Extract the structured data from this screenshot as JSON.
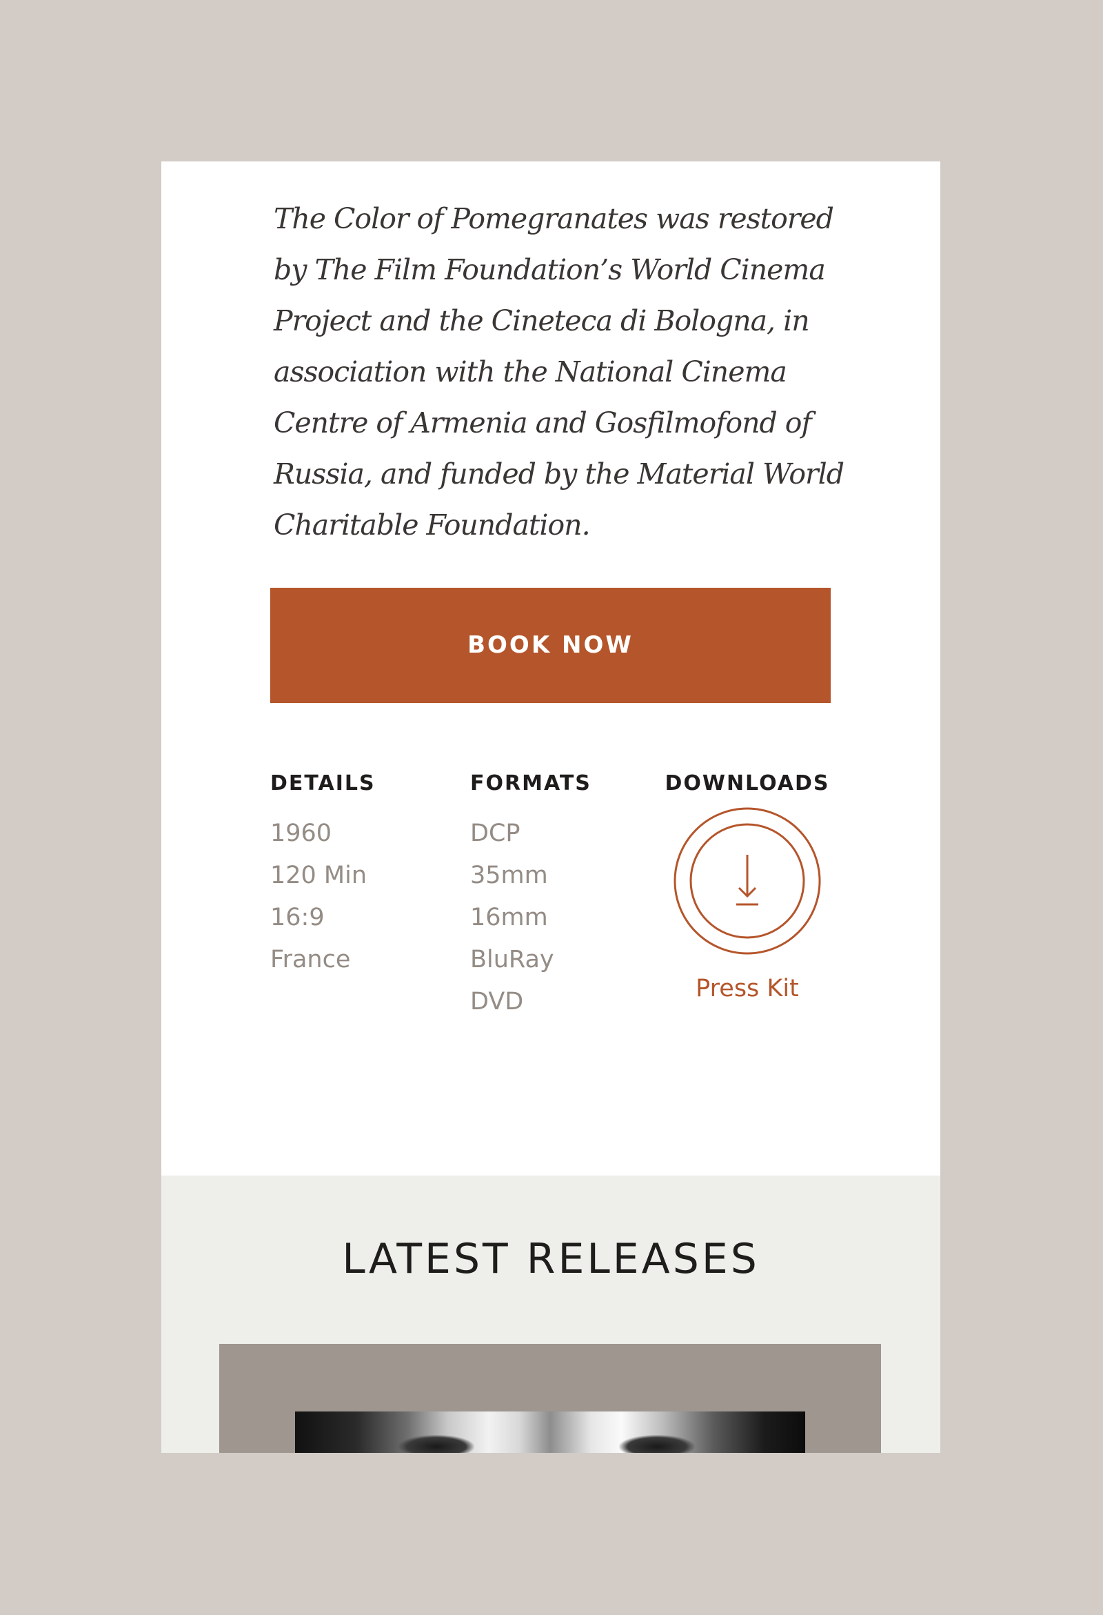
{
  "intro": {
    "text": "The Color of Pomegranates was restored by The Film Foundation’s World Cinema Project and the Cineteca di Bologna, in association with the National Cinema Centre of Armenia and Gosfilmofond of Russia, and funded by the Material World Charitable Foundation."
  },
  "booking": {
    "button_label": "BOOK NOW"
  },
  "details": {
    "heading": "DETAILS",
    "items": [
      "1960",
      "120 Min",
      "16:9",
      "France"
    ]
  },
  "formats": {
    "heading": "FORMATS",
    "items": [
      "DCP",
      "35mm",
      "16mm",
      "BluRay",
      "DVD"
    ]
  },
  "downloads": {
    "heading": "DOWNLOADS",
    "icon": "download-icon",
    "link_label": "Press Kit"
  },
  "latest": {
    "title": "LATEST RELEASES"
  },
  "colors": {
    "accent": "#b5552b",
    "page_background": "#d3ccc6",
    "section_background": "#eeeeeb",
    "muted_text": "#948c85"
  }
}
